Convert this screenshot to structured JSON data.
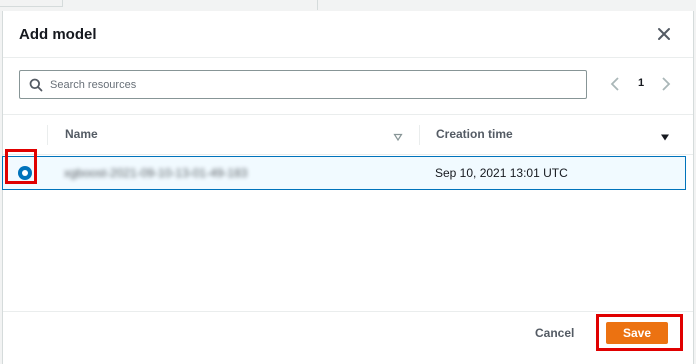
{
  "modal": {
    "title": "Add model",
    "close_icon": "close-icon"
  },
  "search": {
    "placeholder": "Search resources",
    "icon": "search-icon"
  },
  "pagination": {
    "current_page": "1",
    "prev_icon": "chevron-left-icon",
    "next_icon": "chevron-right-icon"
  },
  "table": {
    "columns": [
      {
        "label": "Name",
        "sort_icon": "sort-caret-outline-icon"
      },
      {
        "label": "Creation time",
        "sort_icon": "sort-caret-filled-icon"
      }
    ],
    "rows": [
      {
        "selected": true,
        "name": "xgboost-2021-09-10-13-01-49-183",
        "creation_time": "Sep 10, 2021 13:01 UTC"
      }
    ]
  },
  "footer": {
    "cancel_label": "Cancel",
    "save_label": "Save"
  },
  "colors": {
    "accent": "#0073bb",
    "primary_button": "#ec7211",
    "highlight": "#e00000"
  }
}
